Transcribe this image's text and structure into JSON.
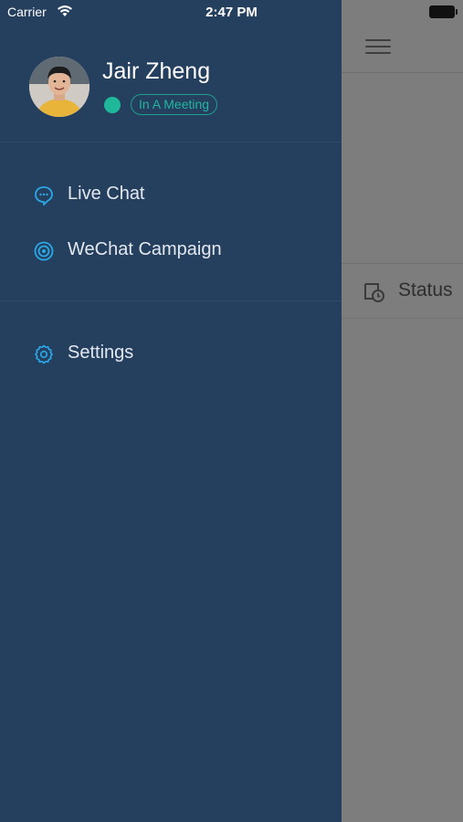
{
  "status_bar": {
    "carrier": "Carrier",
    "time": "2:47 PM"
  },
  "drawer": {
    "user": {
      "name": "Jair Zheng",
      "presence_status": "In A Meeting"
    },
    "menu": {
      "live_chat": "Live Chat",
      "wechat_campaign": "WeChat Campaign",
      "settings": "Settings"
    }
  },
  "background_screen": {
    "status_label": "Status"
  },
  "colors": {
    "drawer_bg": "#253f5e",
    "accent_icon": "#2aa8e8",
    "presence_green": "#1fb89a"
  }
}
